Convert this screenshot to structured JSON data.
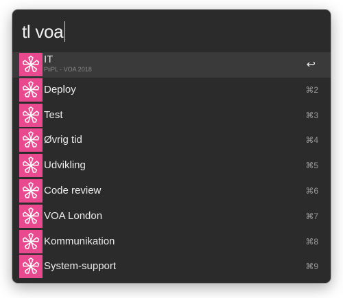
{
  "search": {
    "query": "tl voa"
  },
  "results": [
    {
      "title": "IT",
      "subtitle": "PiiPL - VOA 2018",
      "shortcut": "↩",
      "selected": true,
      "icon": "flower-icon"
    },
    {
      "title": "Deploy",
      "shortcut": "⌘2",
      "icon": "flower-icon"
    },
    {
      "title": "Test",
      "shortcut": "⌘3",
      "icon": "flower-icon"
    },
    {
      "title": "Øvrig tid",
      "shortcut": "⌘4",
      "icon": "flower-icon"
    },
    {
      "title": "Udvikling",
      "shortcut": "⌘5",
      "icon": "flower-icon"
    },
    {
      "title": "Code review",
      "shortcut": "⌘6",
      "icon": "flower-icon"
    },
    {
      "title": "VOA London",
      "shortcut": "⌘7",
      "icon": "flower-icon"
    },
    {
      "title": "Kommunikation",
      "shortcut": "⌘8",
      "icon": "flower-icon"
    },
    {
      "title": "System-support",
      "shortcut": "⌘9",
      "icon": "flower-icon"
    }
  ],
  "colors": {
    "panel": "#2b2b2b",
    "selected_row": "#3a3a3a",
    "icon_background": "#e9498f"
  }
}
